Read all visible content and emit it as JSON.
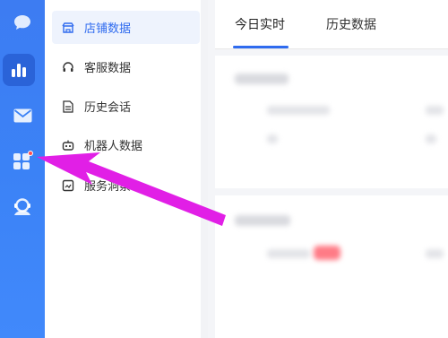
{
  "rail": {
    "items": [
      {
        "icon": "chat-bubble-icon"
      },
      {
        "icon": "bar-chart-icon",
        "active": true
      },
      {
        "icon": "mail-icon"
      },
      {
        "icon": "apps-grid-icon",
        "badge": true
      },
      {
        "icon": "support-agent-icon"
      }
    ]
  },
  "menu": {
    "items": [
      {
        "label": "店铺数据",
        "icon": "store-icon",
        "active": true
      },
      {
        "label": "客服数据",
        "icon": "headset-icon"
      },
      {
        "label": "历史会话",
        "icon": "document-icon"
      },
      {
        "label": "机器人数据",
        "icon": "robot-icon"
      },
      {
        "label": "服务洞察",
        "icon": "insight-icon"
      }
    ]
  },
  "tabs": [
    {
      "label": "今日实时",
      "active": true
    },
    {
      "label": "历史数据"
    }
  ],
  "colors": {
    "accent": "#2f6bef",
    "rail": "#3b82f6",
    "arrow": "#e11fe6",
    "badge": "#ff4d4f"
  }
}
